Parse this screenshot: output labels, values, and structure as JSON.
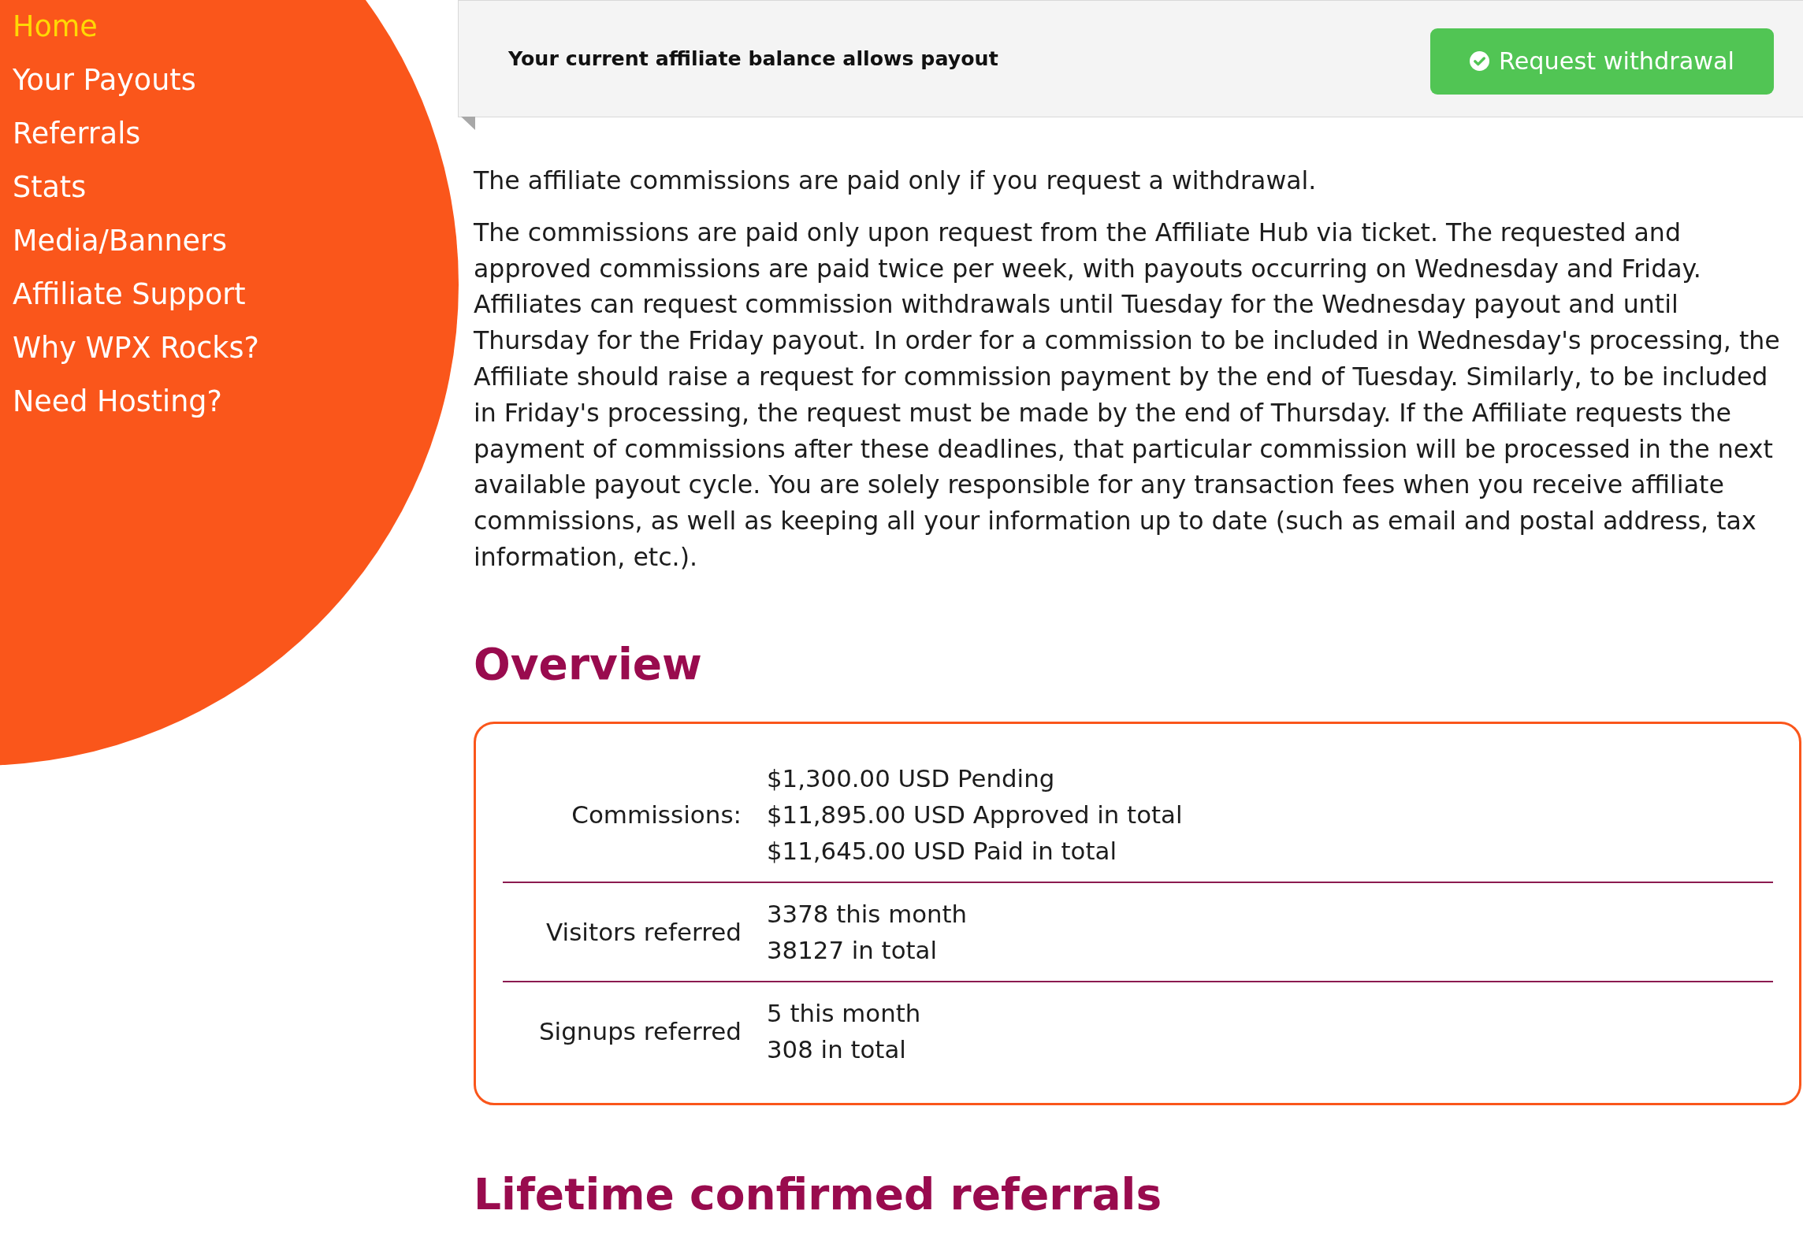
{
  "sidebar": {
    "items": [
      {
        "label": "Home",
        "selected": true
      },
      {
        "label": "Your Payouts",
        "selected": false
      },
      {
        "label": "Referrals",
        "selected": false
      },
      {
        "label": "Stats",
        "selected": false
      },
      {
        "label": "Media/Banners",
        "selected": false
      },
      {
        "label": "Affiliate Support",
        "selected": false
      },
      {
        "label": "Why WPX Rocks?",
        "selected": false
      },
      {
        "label": "Need Hosting?",
        "selected": false
      }
    ]
  },
  "banner": {
    "message": "Your current affiliate balance allows payout",
    "button": {
      "label": "Request withdrawal"
    }
  },
  "payout_info": {
    "paragraphs": [
      "The affiliate commissions are paid only if you request a withdrawal.",
      "The commissions are paid only upon request from the Affiliate Hub via ticket. The requested and approved commissions are paid twice per week, with payouts occurring on Wednesday and Friday. Affiliates can request commission withdrawals until Tuesday for the Wednesday payout and until Thursday for the Friday payout. In order for a commission to be included in Wednesday's processing, the Affiliate should raise a request for commission payment by the end of Tuesday. Similarly, to be included in Friday's processing, the request must be made by the end of Thursday. If the Affiliate requests the payment of commissions after these deadlines, that particular commission will be processed in the next available payout cycle. You are solely responsible for any transaction fees when you receive affiliate commissions, as well as keeping all your information up to date (such as email and postal address, tax information, etc.)."
    ]
  },
  "overview": {
    "title": "Overview",
    "rows": [
      {
        "label": "Commissions:",
        "values": [
          "$1,300.00 USD Pending",
          "$11,895.00 USD Approved in total",
          "$11,645.00 USD Paid in total"
        ]
      },
      {
        "label": "Visitors referred",
        "values": [
          "3378 this month",
          "38127 in total"
        ]
      },
      {
        "label": "Signups referred",
        "values": [
          "5 this month",
          "308 in total"
        ]
      }
    ]
  },
  "lifetime_referrals": {
    "title": "Lifetime confirmed referrals"
  }
}
